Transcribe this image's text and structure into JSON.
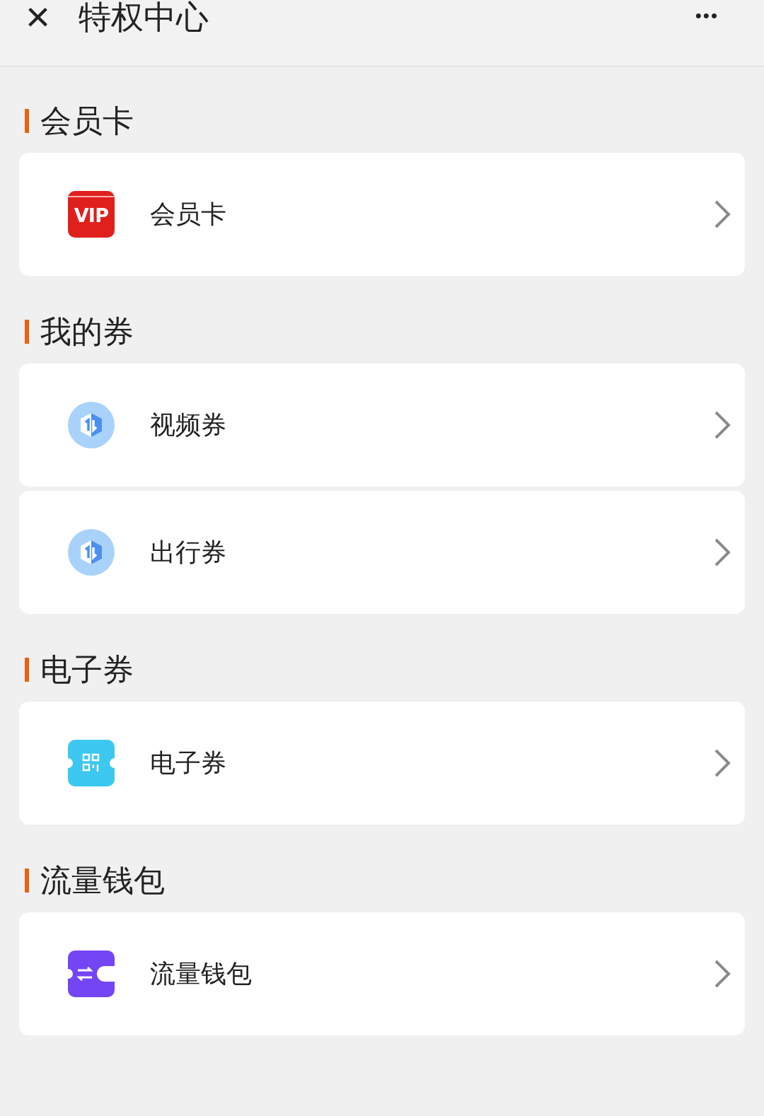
{
  "header": {
    "close": "×",
    "title": "特权中心",
    "more": "•••"
  },
  "sections": [
    {
      "title": "会员卡",
      "items": [
        {
          "label": "会员卡",
          "kind": "vip",
          "badge": "VIP"
        }
      ]
    },
    {
      "title": "我的券",
      "items": [
        {
          "label": "视频券",
          "kind": "coupon"
        },
        {
          "label": "出行券",
          "kind": "coupon"
        }
      ]
    },
    {
      "title": "电子券",
      "items": [
        {
          "label": "电子券",
          "kind": "ticket"
        }
      ]
    },
    {
      "title": "流量钱包",
      "items": [
        {
          "label": "流量钱包",
          "kind": "wallet"
        }
      ]
    }
  ]
}
